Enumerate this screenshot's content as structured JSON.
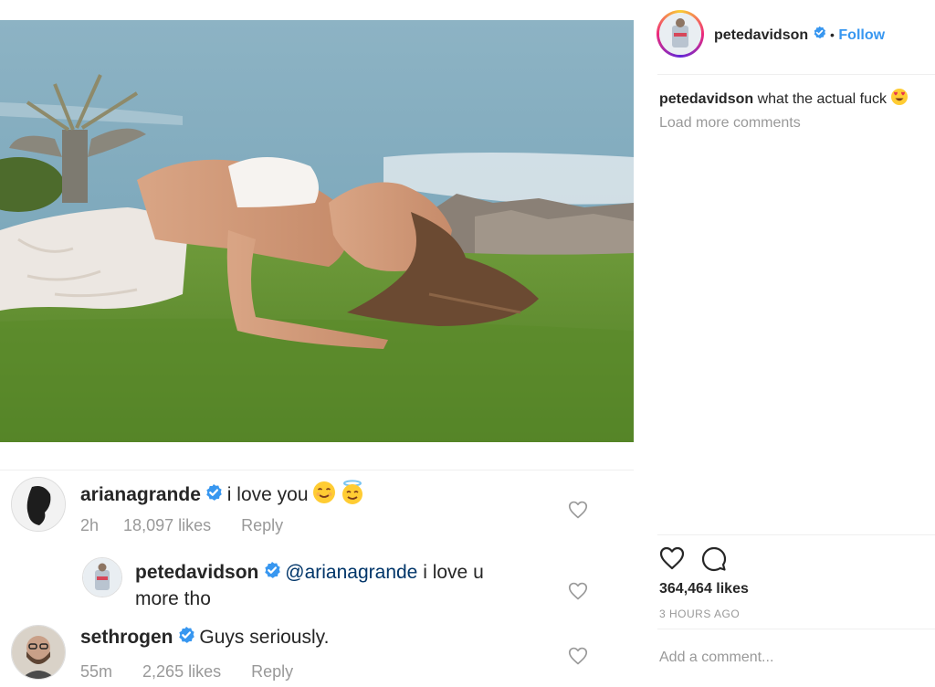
{
  "post": {
    "author": "petedavidson",
    "follow_label": "Follow",
    "separator": "•",
    "caption_author": "petedavidson",
    "caption_text": "what the actual fuck",
    "load_more": "Load more comments",
    "likes": "364,464 likes",
    "time_ago": "3 HOURS AGO",
    "add_comment_placeholder": "Add a comment..."
  },
  "comments": [
    {
      "user": "arianagrande",
      "text": "i love you",
      "time": "2h",
      "likes": "18,097 likes",
      "reply": "Reply"
    },
    {
      "user": "petedavidson",
      "mention": "@arianagrande",
      "text": " i love u",
      "text2": "more tho"
    },
    {
      "user": "sethrogen",
      "text": "Guys seriously.",
      "time": "55m",
      "likes": "2,265 likes",
      "reply": "Reply"
    }
  ],
  "colors": {
    "link_blue": "#3897f0",
    "verified_blue": "#3897f0",
    "muted": "#999999",
    "text": "#262626"
  },
  "icons": [
    "verified-badge-icon",
    "heart-icon",
    "comment-icon",
    "heart-eyes-emoji",
    "smiling-emoji",
    "halo-emoji"
  ]
}
